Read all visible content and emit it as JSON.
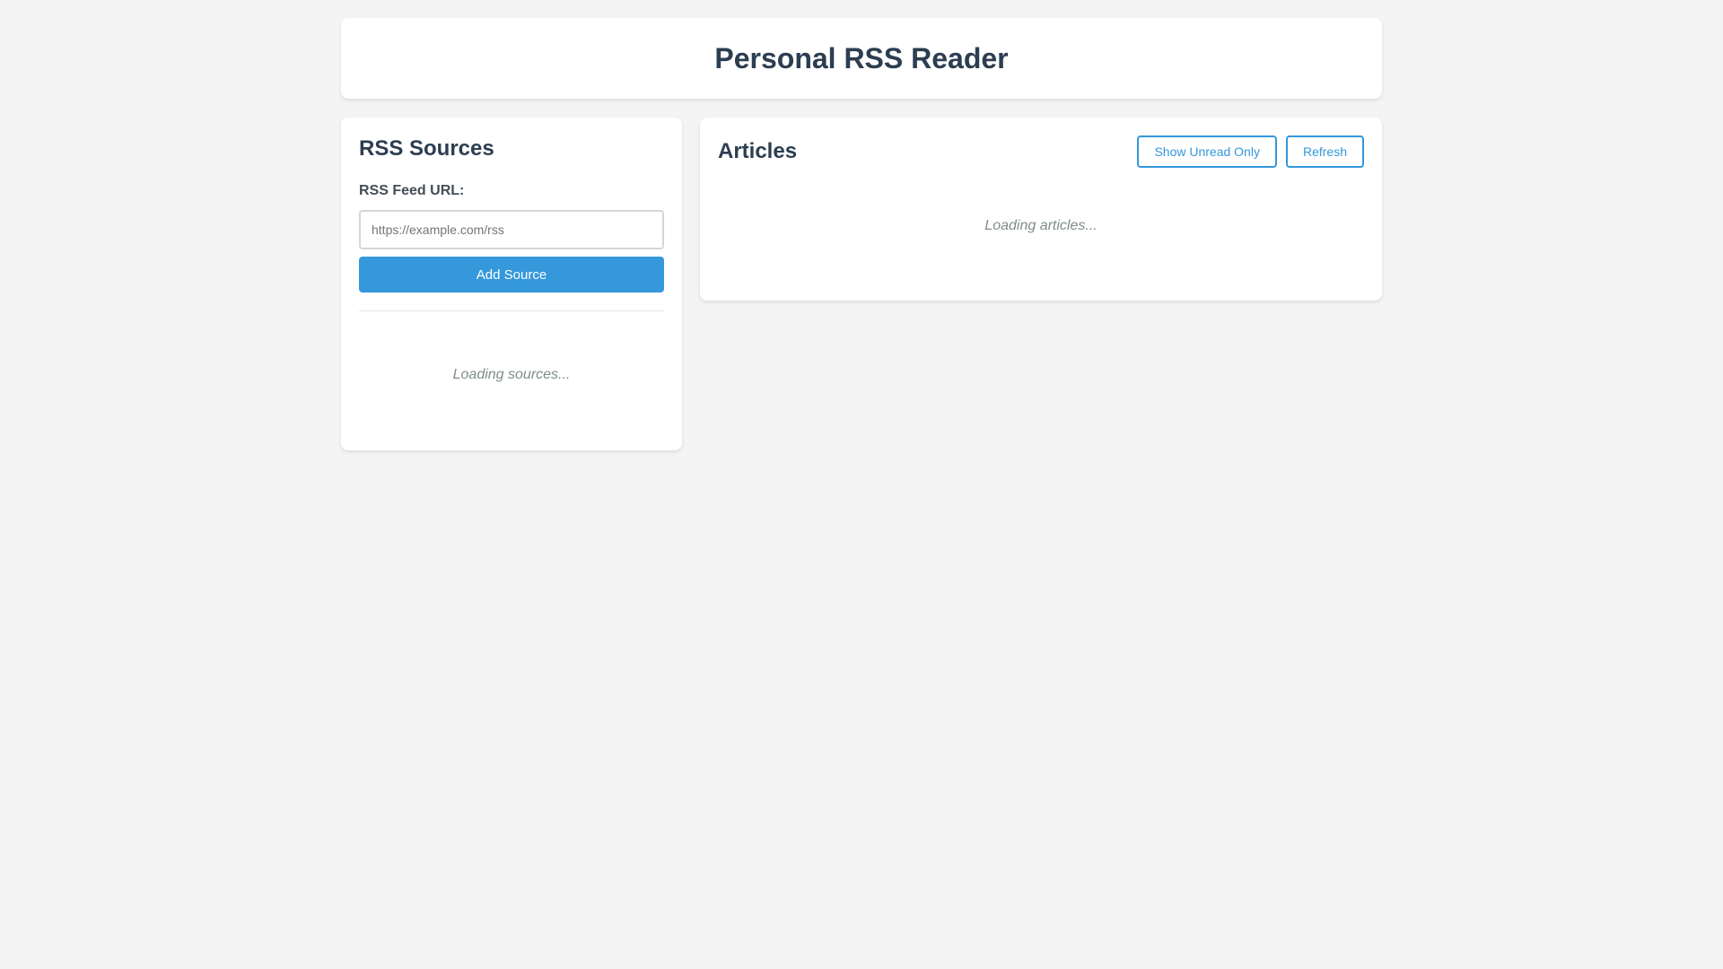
{
  "app": {
    "title": "Personal RSS Reader"
  },
  "sources": {
    "title": "RSS Sources",
    "feed_label": "RSS Feed URL:",
    "input_placeholder": "https://example.com/rss",
    "input_value": "",
    "add_button": "Add Source",
    "loading": "Loading sources..."
  },
  "articles": {
    "title": "Articles",
    "unread_button": "Show Unread Only",
    "refresh_button": "Refresh",
    "loading": "Loading articles..."
  },
  "colors": {
    "accent": "#3498db",
    "heading": "#2c3e50",
    "background": "#f4f4f4",
    "muted": "#7f8c8d"
  }
}
